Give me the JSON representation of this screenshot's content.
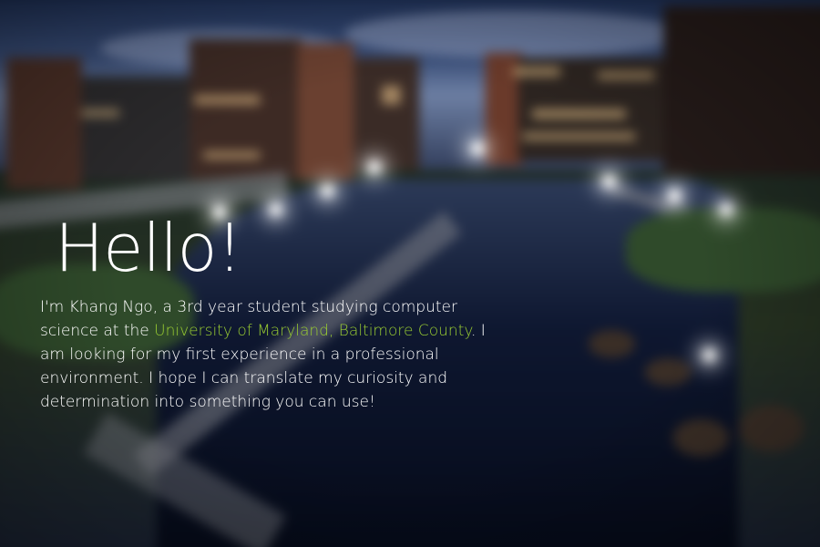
{
  "greeting": "Hello!",
  "intro": {
    "text_before_link": "I'm Khang Ngo, a 3rd year student studying computer science at the ",
    "link_text": "University of Maryland, Baltimore County",
    "text_after_link": ". I am looking for my first experience in a professional environment.  I hope I can translate my curiosity and determination into something you can use!"
  },
  "colors": {
    "text": "#ffffff",
    "link": "#9acd32"
  }
}
